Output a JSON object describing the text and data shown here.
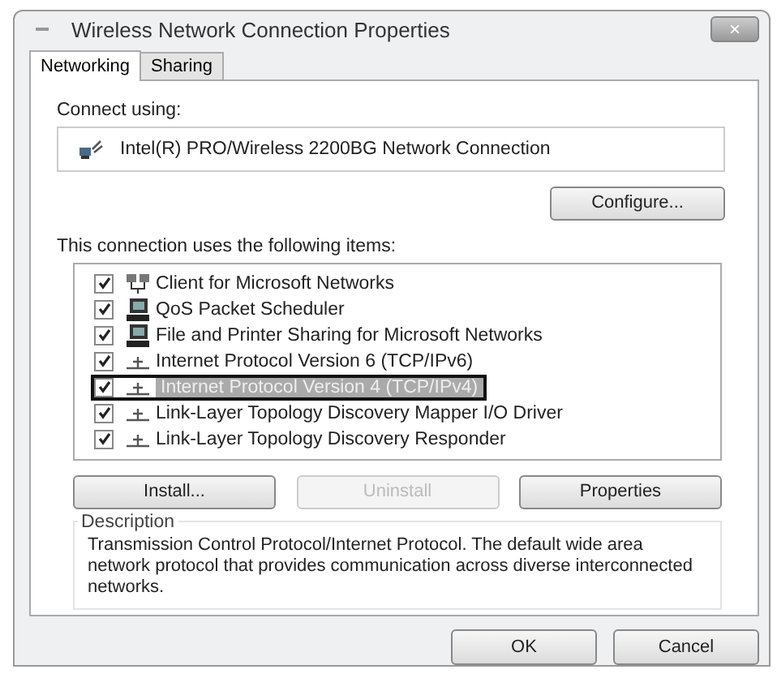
{
  "window": {
    "title": "Wireless Network Connection Properties",
    "close": "×"
  },
  "tabs": [
    {
      "label": "Networking",
      "selected": true
    },
    {
      "label": "Sharing",
      "selected": false
    }
  ],
  "connect_using": {
    "label": "Connect using:",
    "adapter": "Intel(R) PRO/Wireless 2200BG Network Connection",
    "button": "Configure..."
  },
  "items_label": "This connection uses the following items:",
  "items": [
    {
      "kind": "client",
      "label": "Client for Microsoft Networks",
      "checked": true,
      "selected": false
    },
    {
      "kind": "service",
      "label": "QoS Packet Scheduler",
      "checked": true,
      "selected": false
    },
    {
      "kind": "service",
      "label": "File and Printer Sharing for Microsoft Networks",
      "checked": true,
      "selected": false
    },
    {
      "kind": "protocol",
      "label": "Internet Protocol Version 6 (TCP/IPv6)",
      "checked": true,
      "selected": false
    },
    {
      "kind": "protocol",
      "label": "Internet Protocol Version 4 (TCP/IPv4)",
      "checked": true,
      "selected": true
    },
    {
      "kind": "protocol",
      "label": "Link-Layer Topology Discovery Mapper I/O Driver",
      "checked": true,
      "selected": false
    },
    {
      "kind": "protocol",
      "label": "Link-Layer Topology Discovery Responder",
      "checked": true,
      "selected": false
    }
  ],
  "item_buttons": [
    {
      "label": "Install...",
      "disabled": false
    },
    {
      "label": "Uninstall",
      "disabled": true
    },
    {
      "label": "Properties",
      "disabled": false
    }
  ],
  "description": {
    "title": "Description",
    "text": "Transmission Control Protocol/Internet Protocol. The default wide area network protocol that provides communication across diverse interconnected networks."
  },
  "buttons": [
    "OK",
    "Cancel"
  ]
}
